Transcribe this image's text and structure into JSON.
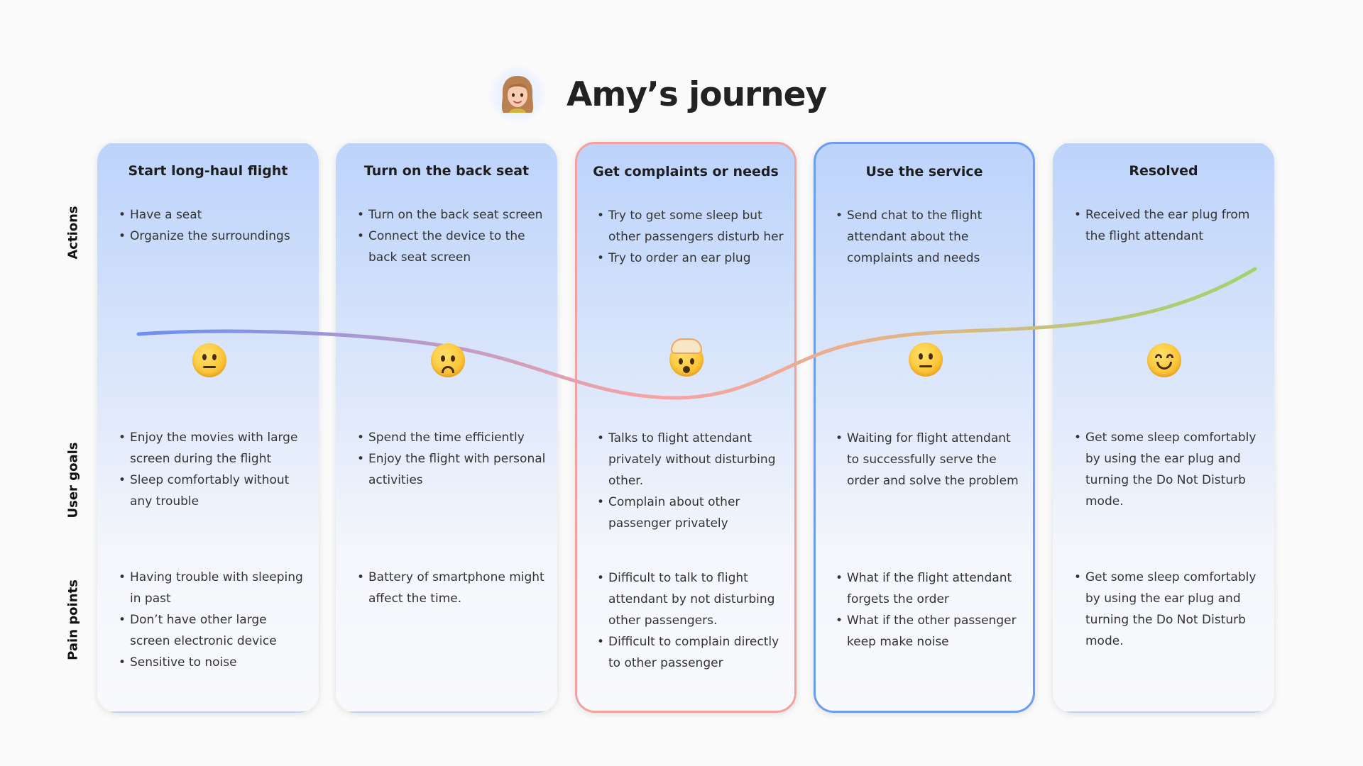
{
  "header": {
    "title": "Amy’s journey"
  },
  "row_labels": {
    "actions": "Actions",
    "goals": "User goals",
    "pain": "Pain points"
  },
  "colors": {
    "card_top": "#bcd3fb",
    "card_bottom": "#f8f9fc",
    "highlight_red": "#f5a0a0",
    "highlight_blue": "#6b9df0",
    "curve_start": "#6b8ff0",
    "curve_mid": "#f4a3a8",
    "curve_end": "#9fd46a"
  },
  "stages": [
    {
      "title": "Start long-haul flight",
      "emotion": "neutral-face-icon",
      "actions": [
        "Have a seat",
        "Organize the surroundings"
      ],
      "goals": [
        "Enjoy the movies with large screen during the flight",
        "Sleep comfortably without any trouble"
      ],
      "pain_points": [
        "Having trouble with sleeping in past",
        "Don’t have other large screen electronic device",
        "Sensitive to noise"
      ]
    },
    {
      "title": "Turn on the back seat",
      "emotion": "worried-face-icon",
      "actions": [
        "Turn on the back seat screen",
        "Connect the device to the back seat screen"
      ],
      "goals": [
        "Spend the time efficiently",
        "Enjoy the flight with personal activities"
      ],
      "pain_points": [
        "Battery of smartphone might affect the time."
      ]
    },
    {
      "title": "Get complaints or needs",
      "emotion": "exploding-head-icon",
      "actions": [
        "Try to get some sleep but other passengers disturb her",
        "Try to order an ear plug"
      ],
      "goals": [
        "Talks to flight attendant privately without disturbing other.",
        "Complain about other passenger privately"
      ],
      "pain_points": [
        "Difficult to talk to flight attendant by not disturbing other passengers.",
        "Difficult to complain directly to other passenger"
      ]
    },
    {
      "title": "Use the service",
      "emotion": "neutral-face-icon",
      "actions": [
        "Send chat to the flight attendant about the complaints and needs"
      ],
      "goals": [
        "Waiting for flight attendant to successfully serve the order and solve the problem"
      ],
      "pain_points": [
        "What if the flight attendant forgets the order",
        "What if the other passenger keep make noise"
      ]
    },
    {
      "title": "Resolved",
      "emotion": "smiling-face-icon",
      "actions": [
        "Received the ear plug from the flight attendant"
      ],
      "goals": [
        "Get some sleep comfortably by using the ear plug and turning the Do Not Disturb mode."
      ],
      "pain_points": [
        "Get some sleep comfortably by using the ear plug and turning the Do Not Disturb mode."
      ]
    }
  ]
}
